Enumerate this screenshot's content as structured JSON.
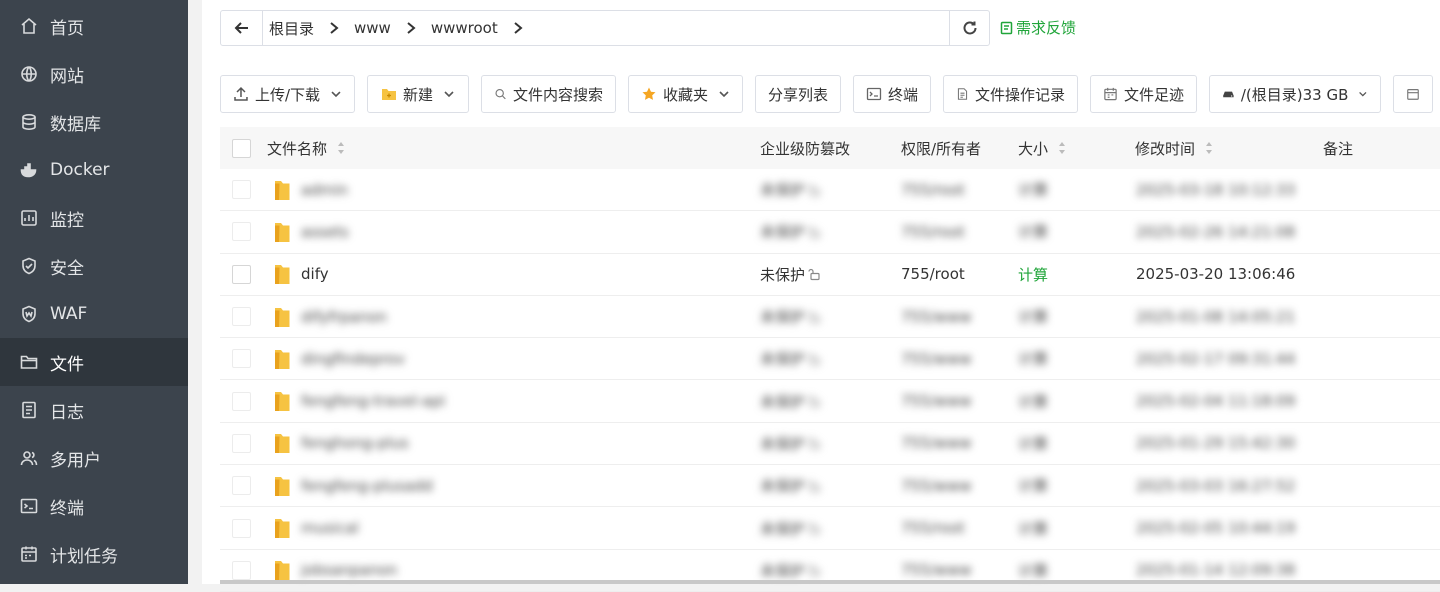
{
  "sidebar": {
    "items": [
      {
        "label": "首页",
        "icon": "home-icon",
        "active": false
      },
      {
        "label": "网站",
        "icon": "globe-icon",
        "active": false
      },
      {
        "label": "数据库",
        "icon": "database-icon",
        "active": false
      },
      {
        "label": "Docker",
        "icon": "docker-icon",
        "active": false
      },
      {
        "label": "监控",
        "icon": "monitor-icon",
        "active": false
      },
      {
        "label": "安全",
        "icon": "shield-icon",
        "active": false
      },
      {
        "label": "WAF",
        "icon": "waf-shield-icon",
        "active": false
      },
      {
        "label": "文件",
        "icon": "folder-icon",
        "active": true
      },
      {
        "label": "日志",
        "icon": "log-icon",
        "active": false
      },
      {
        "label": "多用户",
        "icon": "users-icon",
        "active": false
      },
      {
        "label": "终端",
        "icon": "terminal-icon",
        "active": false
      },
      {
        "label": "计划任务",
        "icon": "calendar-icon",
        "active": false
      }
    ]
  },
  "address": {
    "crumbs": [
      "根目录",
      "www",
      "wwwroot"
    ],
    "feedback": "需求反馈"
  },
  "toolbar": {
    "upload": "上传/下载",
    "new": "新建",
    "search": "文件内容搜索",
    "favorites": "收藏夹",
    "share": "分享列表",
    "terminal": "终端",
    "oplog": "文件操作记录",
    "footprint": "文件足迹",
    "disk": "/(根目录)33 GB"
  },
  "table": {
    "headers": {
      "name": "文件名称",
      "tamper": "企业级防篡改",
      "perm": "权限/所有者",
      "size": "大小",
      "mtime": "修改时间",
      "note": "备注"
    },
    "rows": [
      {
        "name": "admin",
        "tamper": "未保护",
        "perm": "755/root",
        "size": "计算",
        "mtime": "2025-03-18 10:12:33",
        "blurred": true
      },
      {
        "name": "assets",
        "tamper": "未保护",
        "perm": "755/root",
        "size": "计算",
        "mtime": "2025-02-26 14:21:08",
        "blurred": true
      },
      {
        "name": "dify",
        "tamper": "未保护",
        "perm": "755/root",
        "size": "计算",
        "mtime": "2025-03-20 13:06:46",
        "blurred": false
      },
      {
        "name": "difyfrpanon",
        "tamper": "未保护",
        "perm": "755/www",
        "size": "计算",
        "mtime": "2025-01-08 14:05:21",
        "blurred": true
      },
      {
        "name": "dingfindeprov",
        "tamper": "未保护",
        "perm": "755/www",
        "size": "计算",
        "mtime": "2025-02-17 09:31:44",
        "blurred": true
      },
      {
        "name": "fengfeng-travel-api",
        "tamper": "未保护",
        "perm": "755/www",
        "size": "计算",
        "mtime": "2025-02-04 11:18:09",
        "blurred": true
      },
      {
        "name": "fenghong-plus",
        "tamper": "未保护",
        "perm": "755/www",
        "size": "计算",
        "mtime": "2025-01-29 15:42:30",
        "blurred": true
      },
      {
        "name": "fengfeng-plusadd",
        "tamper": "未保护",
        "perm": "755/www",
        "size": "计算",
        "mtime": "2025-03-03 16:27:52",
        "blurred": true
      },
      {
        "name": "musical",
        "tamper": "未保护",
        "perm": "755/root",
        "size": "计算",
        "mtime": "2025-02-05 10:44:19",
        "blurred": true
      },
      {
        "name": "jobsanpanon",
        "tamper": "未保护",
        "perm": "755/www",
        "size": "计算",
        "mtime": "2025-01-14 12:09:38",
        "blurred": true
      }
    ]
  },
  "colors": {
    "sidebar_bg": "#3c444d",
    "sidebar_active": "#2f363d",
    "accent_green": "#20a53a",
    "folder_yellow": "#f6c342"
  }
}
